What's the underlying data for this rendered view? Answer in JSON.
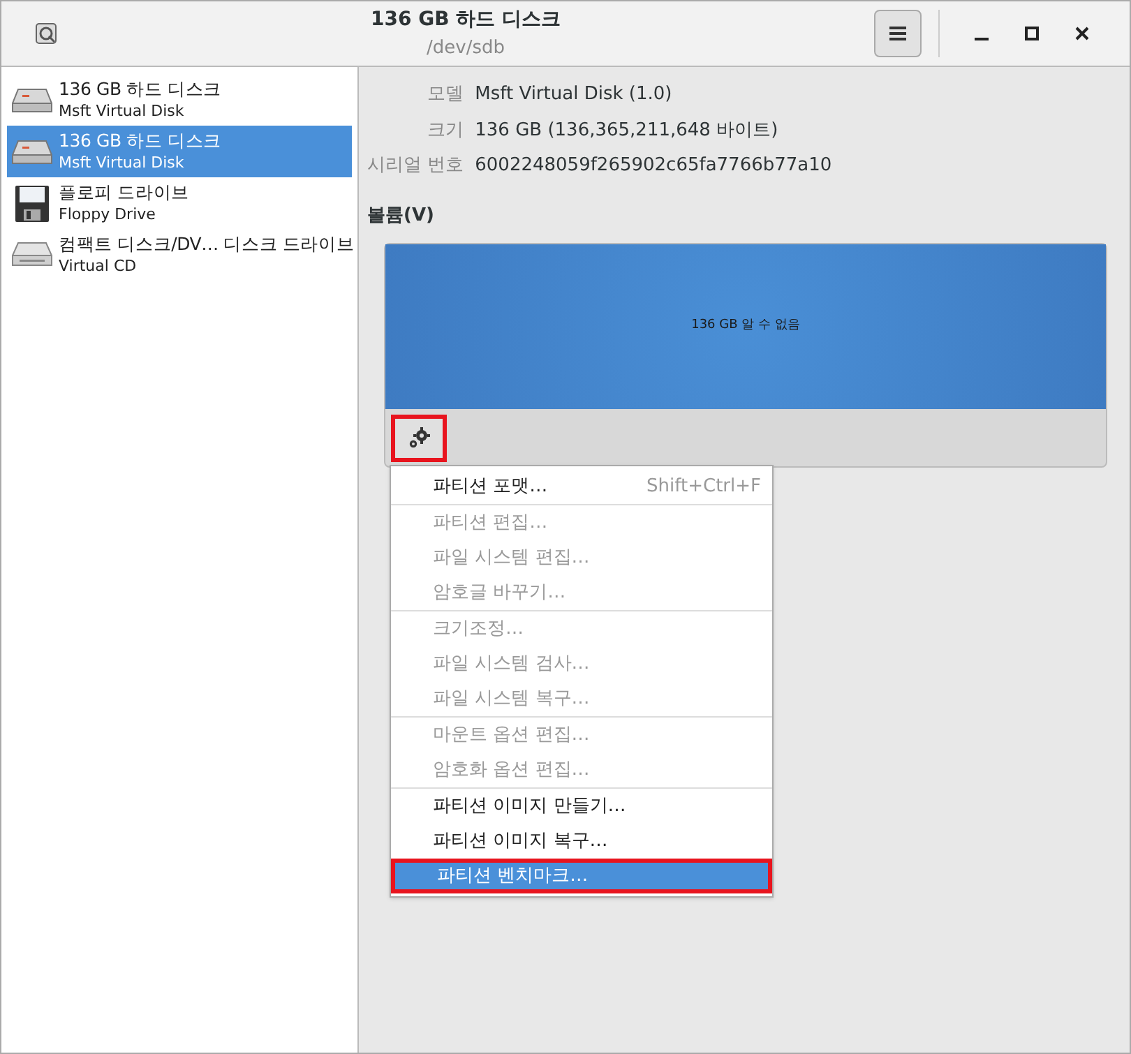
{
  "window": {
    "title": "136 GB 하드 디스크",
    "subtitle": "/dev/sdb"
  },
  "sidebar": {
    "items": [
      {
        "kind": "disk",
        "title": "136 GB 하드 디스크",
        "subtitle": "Msft Virtual Disk",
        "selected": false
      },
      {
        "kind": "disk",
        "title": "136 GB 하드 디스크",
        "subtitle": "Msft Virtual Disk",
        "selected": true
      },
      {
        "kind": "floppy",
        "title": "플로피 드라이브",
        "subtitle": "Floppy Drive",
        "selected": false
      },
      {
        "kind": "optical",
        "title": "컴팩트 디스크/DV… 디스크 드라이브",
        "subtitle": "Virtual CD",
        "selected": false
      }
    ]
  },
  "details": [
    {
      "label": "모델",
      "value": "Msft Virtual Disk (1.0)"
    },
    {
      "label": "크기",
      "value": "136 GB (136,365,211,648 바이트)"
    },
    {
      "label": "시리얼 번호",
      "value": "6002248059f265902c65fa7766b77a10"
    }
  ],
  "volumes": {
    "heading": "볼륨(V)",
    "partition": "136 GB 알 수 없음",
    "gear_outlined": true
  },
  "menu": {
    "groups": [
      [
        {
          "label": "파티션 포맷…",
          "shortcut": "Shift+Ctrl+F",
          "disabled": false,
          "selected": false,
          "outlined": false
        }
      ],
      [
        {
          "label": "파티션 편집…",
          "disabled": true,
          "selected": false,
          "outlined": false
        },
        {
          "label": "파일 시스템 편집…",
          "disabled": true,
          "selected": false,
          "outlined": false
        },
        {
          "label": "암호글 바꾸기…",
          "disabled": true,
          "selected": false,
          "outlined": false
        }
      ],
      [
        {
          "label": "크기조정…",
          "disabled": true,
          "selected": false,
          "outlined": false
        },
        {
          "label": "파일 시스템 검사…",
          "disabled": true,
          "selected": false,
          "outlined": false
        },
        {
          "label": "파일 시스템 복구…",
          "disabled": true,
          "selected": false,
          "outlined": false
        }
      ],
      [
        {
          "label": "마운트 옵션 편집…",
          "disabled": true,
          "selected": false,
          "outlined": false
        },
        {
          "label": "암호화 옵션 편집…",
          "disabled": true,
          "selected": false,
          "outlined": false
        }
      ],
      [
        {
          "label": "파티션 이미지 만들기…",
          "disabled": false,
          "selected": false,
          "outlined": false
        },
        {
          "label": "파티션 이미지 복구…",
          "disabled": false,
          "selected": false,
          "outlined": false
        },
        {
          "label": "파티션 벤치마크…",
          "disabled": false,
          "selected": true,
          "outlined": true
        }
      ]
    ]
  }
}
